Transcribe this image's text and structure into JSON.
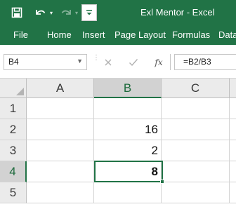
{
  "titlebar": {
    "title": "Exl Mentor  -  Excel",
    "quick_access": [
      "save-icon",
      "undo-icon",
      "redo-icon",
      "customize-quick-access-icon"
    ]
  },
  "ribbon": {
    "tabs": [
      "File",
      "Home",
      "Insert",
      "Page Layout",
      "Formulas",
      "Data"
    ]
  },
  "formula_bar": {
    "name_box": "B4",
    "fx_label": "fx",
    "formula": "=B2/B3"
  },
  "sheet": {
    "columns": [
      "A",
      "B",
      "C"
    ],
    "selected_column": "B",
    "rows": [
      {
        "number": "1",
        "A": "",
        "B": "",
        "C": ""
      },
      {
        "number": "2",
        "A": "",
        "B": "16",
        "C": ""
      },
      {
        "number": "3",
        "A": "",
        "B": "2",
        "C": ""
      },
      {
        "number": "4",
        "A": "",
        "B": "8",
        "C": ""
      },
      {
        "number": "5",
        "A": "",
        "B": "",
        "C": ""
      }
    ],
    "selected_row": "4",
    "active_cell": "B4"
  },
  "colors": {
    "excel_green": "#217346",
    "header_gray": "#ebebeb",
    "gridline": "#d4d4d4"
  }
}
